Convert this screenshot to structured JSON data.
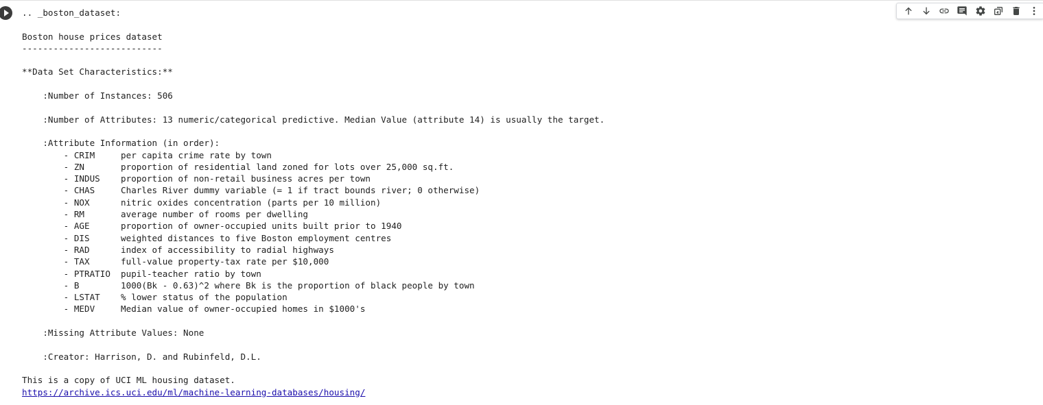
{
  "output": {
    "lines": [
      ".. _boston_dataset:",
      "",
      "Boston house prices dataset",
      "---------------------------",
      "",
      "**Data Set Characteristics:**",
      "",
      "    :Number of Instances: 506",
      "",
      "    :Number of Attributes: 13 numeric/categorical predictive. Median Value (attribute 14) is usually the target.",
      "",
      "    :Attribute Information (in order):",
      "        - CRIM     per capita crime rate by town",
      "        - ZN       proportion of residential land zoned for lots over 25,000 sq.ft.",
      "        - INDUS    proportion of non-retail business acres per town",
      "        - CHAS     Charles River dummy variable (= 1 if tract bounds river; 0 otherwise)",
      "        - NOX      nitric oxides concentration (parts per 10 million)",
      "        - RM       average number of rooms per dwelling",
      "        - AGE      proportion of owner-occupied units built prior to 1940",
      "        - DIS      weighted distances to five Boston employment centres",
      "        - RAD      index of accessibility to radial highways",
      "        - TAX      full-value property-tax rate per $10,000",
      "        - PTRATIO  pupil-teacher ratio by town",
      "        - B        1000(Bk - 0.63)^2 where Bk is the proportion of black people by town",
      "        - LSTAT    % lower status of the population",
      "        - MEDV     Median value of owner-occupied homes in $1000's",
      "",
      "    :Missing Attribute Values: None",
      "",
      "    :Creator: Harrison, D. and Rubinfeld, D.L.",
      "",
      "This is a copy of UCI ML housing dataset."
    ],
    "link": "https://archive.ics.uci.edu/ml/machine-learning-databases/housing/"
  },
  "toolbar": {
    "icons": [
      "arrow-up-icon",
      "arrow-down-icon",
      "link-icon",
      "comment-icon",
      "gear-icon",
      "mirror-cell-icon",
      "trash-icon",
      "more-vert-icon"
    ]
  },
  "colors": {
    "text": "#212121",
    "link": "#1a0dab",
    "icon": "#444746",
    "run_button": "#3c3c3c"
  }
}
